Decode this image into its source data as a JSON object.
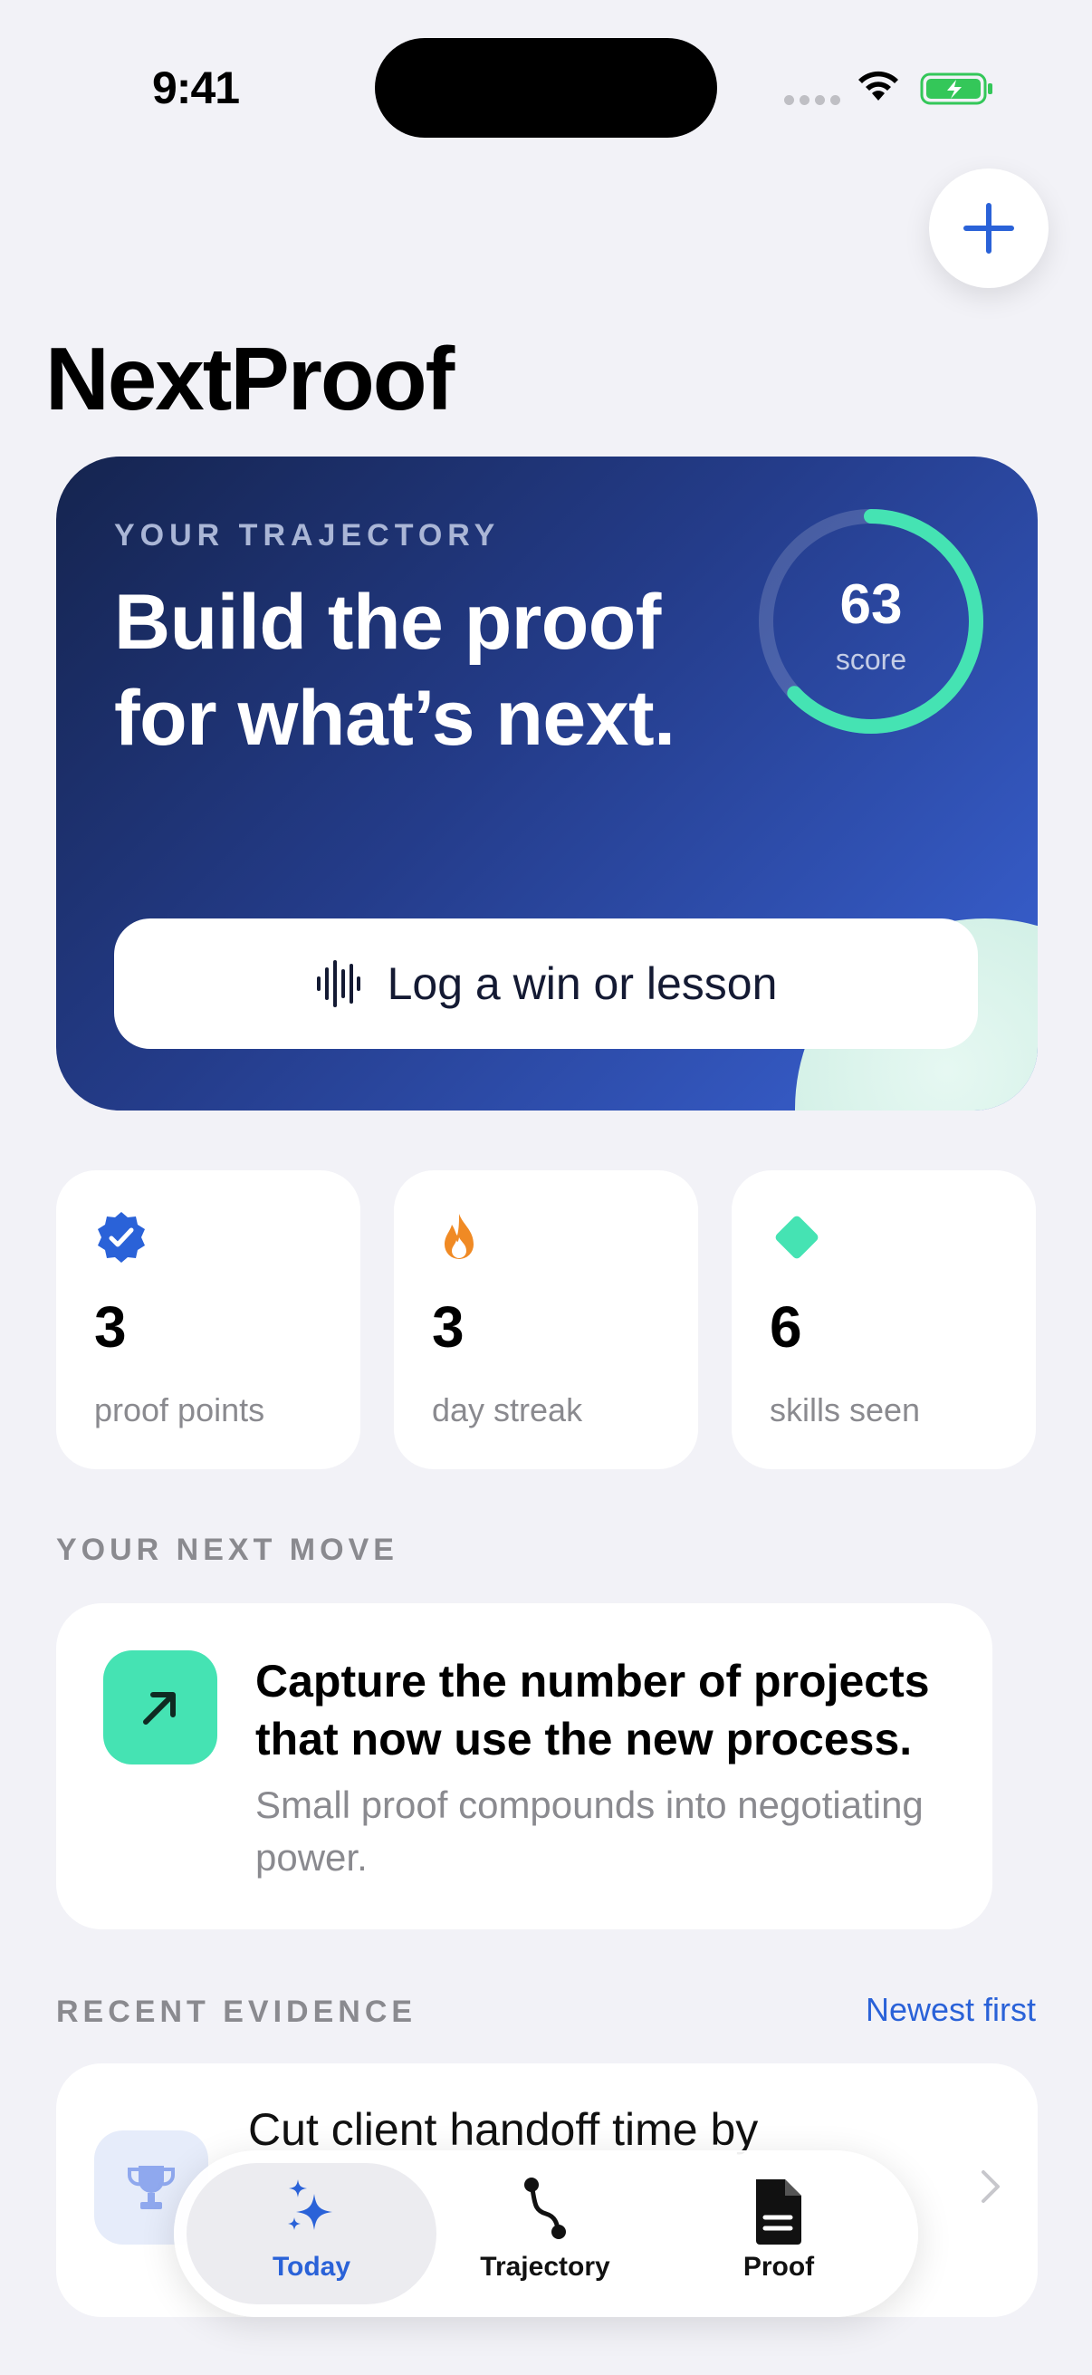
{
  "status_bar": {
    "time": "9:41"
  },
  "header": {
    "title": "NextProof"
  },
  "hero": {
    "kicker": "YOUR TRAJECTORY",
    "headline": "Build the proof for what’s next.",
    "score_value": "63",
    "score_label": "score",
    "score_fraction": 0.63,
    "log_button_label": "Log a win or lesson"
  },
  "stats": [
    {
      "value": "3",
      "label": "proof points",
      "icon": "verified-badge-icon",
      "color": "#2a62d8"
    },
    {
      "value": "3",
      "label": "day streak",
      "icon": "flame-icon",
      "color": "#f08a24"
    },
    {
      "value": "6",
      "label": "skills seen",
      "icon": "diamond-icon",
      "color": "#45e3b3"
    }
  ],
  "next_move": {
    "section_label": "YOUR NEXT MOVE",
    "title": "Capture the number of projects that now use the new process.",
    "subtitle": "Small proof compounds into negotiating power."
  },
  "recent": {
    "section_label": "RECENT EVIDENCE",
    "sort_label": "Newest first",
    "items": [
      {
        "title": "Cut client handoff time by"
      }
    ]
  },
  "tabs": [
    {
      "label": "Today",
      "icon": "sparkles-icon",
      "active": true
    },
    {
      "label": "Trajectory",
      "icon": "path-icon",
      "active": false
    },
    {
      "label": "Proof",
      "icon": "document-icon",
      "active": false
    }
  ],
  "colors": {
    "accent": "#2a62d8",
    "mint": "#45e3b3",
    "background": "#f2f2f7"
  }
}
